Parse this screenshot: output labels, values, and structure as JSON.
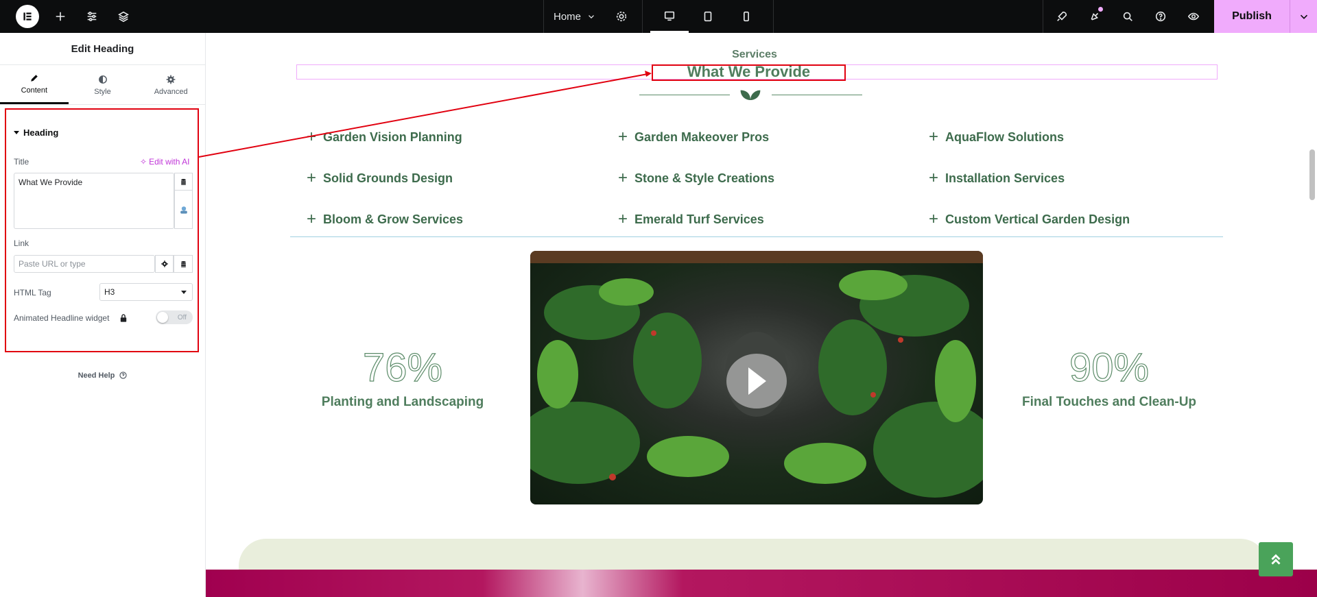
{
  "topbar": {
    "page_name": "Home",
    "publish_label": "Publish",
    "colors": {
      "bar": "#0c0d0e",
      "publish": "#f0abfc"
    }
  },
  "panel": {
    "title": "Edit Heading",
    "tabs": [
      {
        "label": "Content",
        "icon": "pencil-icon"
      },
      {
        "label": "Style",
        "icon": "half-circle-icon"
      },
      {
        "label": "Advanced",
        "icon": "gear-icon"
      }
    ],
    "section_title": "Heading",
    "title_label": "Title",
    "edit_ai_label": "Edit with AI",
    "title_value": "What We Provide",
    "link_label": "Link",
    "link_placeholder": "Paste URL or type",
    "html_tag_label": "HTML Tag",
    "html_tag_value": "H3",
    "animated_label": "Animated Headline widget",
    "toggle_label": "Off",
    "need_help": "Need Help"
  },
  "canvas": {
    "eyebrow": "Services",
    "heading": "What We Provide",
    "services": [
      "Garden Vision Planning",
      "Garden Makeover Pros",
      "AquaFlow Solutions",
      "Solid Grounds Design",
      "Stone & Style Creations",
      "Installation Services",
      "Bloom & Grow Services",
      "Emerald Turf Services",
      "Custom Vertical Garden Design"
    ],
    "stats": [
      {
        "value": "76%",
        "label": "Planting and Landscaping"
      },
      {
        "value": "90%",
        "label": "Final Touches and Clean-Up"
      }
    ],
    "colors": {
      "green": "#3d6b4c",
      "accent": "#e1000f",
      "banner": "#a0004f"
    }
  }
}
